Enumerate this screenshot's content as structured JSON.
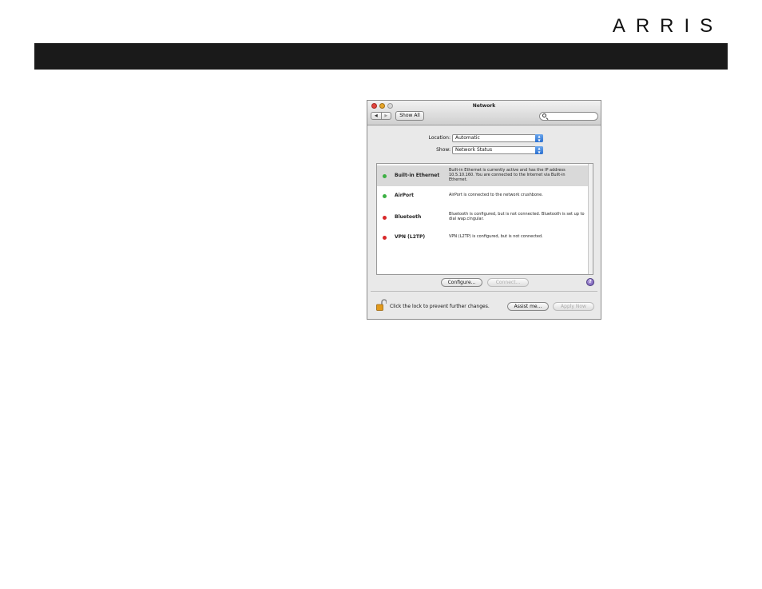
{
  "brand": {
    "logo_text": "ARRIS"
  },
  "window": {
    "title": "Network",
    "nav_back": "◀",
    "nav_forward": "▶",
    "show_all_label": "Show All",
    "search_placeholder": ""
  },
  "location": {
    "label": "Location:",
    "value": "Automatic"
  },
  "show": {
    "label": "Show:",
    "value": "Network Status"
  },
  "services": [
    {
      "name": "Built-in Ethernet",
      "status_color": "#3cb043",
      "selected": true,
      "description": "Built-in Ethernet is currently active and has the IP address 10.5.10.160. You are connected to the Internet via Built-in Ethernet."
    },
    {
      "name": "AirPort",
      "status_color": "#3cb043",
      "selected": false,
      "description": "AirPort is connected to the network crushbone."
    },
    {
      "name": "Bluetooth",
      "status_color": "#d8282a",
      "selected": false,
      "description": "Bluetooth is configured, but is not connected. Bluetooth is set up to dial wap.cingular."
    },
    {
      "name": "VPN (L2TP)",
      "status_color": "#d8282a",
      "selected": false,
      "description": "VPN (L2TP) is configured, but is not connected."
    }
  ],
  "buttons": {
    "configure": "Configure...",
    "connect": "Connect...",
    "help": "?",
    "assist": "Assist me...",
    "apply": "Apply Now"
  },
  "footer": {
    "lock_message": "Click the lock to prevent further changes.",
    "lock_icon": "padlock-open-icon"
  },
  "colors": {
    "banner": "#1a1a1a",
    "popup_accent": "#2a6fcf"
  }
}
